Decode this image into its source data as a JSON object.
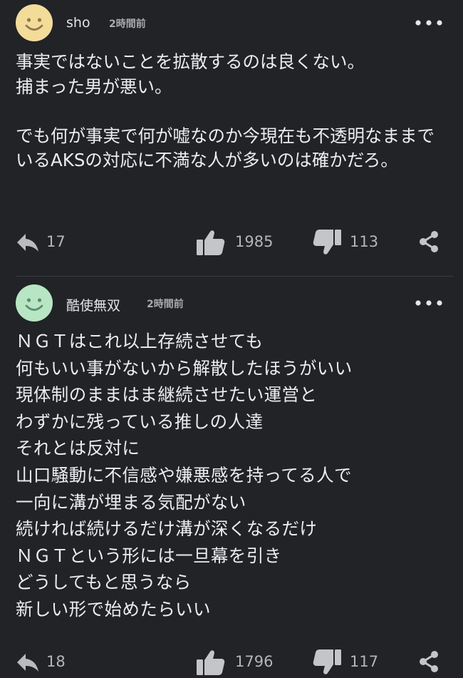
{
  "comments": [
    {
      "username": "sho",
      "time": "2時間前",
      "body": "事実ではないことを拡散するのは良くない。\n捕まった男が悪い。\n\nでも何が事実で何が嘘なのか今現在も不透明なままでいるAKSの対応に不満な人が多いのは確かだろ。",
      "reply_count": "17",
      "like_count": "1985",
      "dislike_count": "113",
      "avatar_color": "#f3dc9a"
    },
    {
      "username": "酷使無双",
      "time": "2時間前",
      "body": "ＮＧＴはこれ以上存続させても\n何もいい事がないから解散したほうがいい\n現体制のままはま継続させたい運営と\nわずかに残っている推しの人達\nそれとは反対に\n山口騒動に不信感や嫌悪感を持ってる人で\n一向に溝が埋まる気配がない\n続ければ続けるだけ溝が深くなるだけ\nＮＧＴという形には一旦幕を引き\nどうしてもと思うなら\n新しい形で始めたらいい",
      "reply_count": "18",
      "like_count": "1796",
      "dislike_count": "117",
      "avatar_color": "#b8e6c4"
    }
  ],
  "icons": {
    "more": "more-horizontal-icon",
    "reply": "reply-arrow-icon",
    "like": "thumbs-up-icon",
    "dislike": "thumbs-down-icon",
    "share": "share-icon"
  },
  "colors": {
    "background": "#212327",
    "text": "#ededee",
    "muted": "#b3b5b9"
  }
}
